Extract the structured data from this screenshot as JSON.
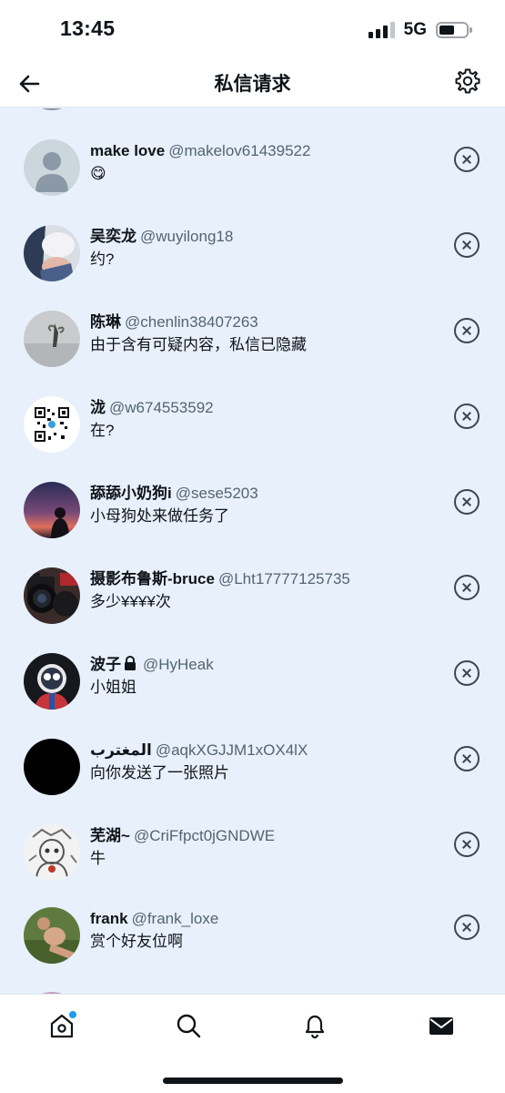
{
  "status_bar": {
    "time": "13:45",
    "network": "5G"
  },
  "nav": {
    "title": "私信请求"
  },
  "requests": [
    {
      "name": "make love",
      "handle": "@makelov61439522",
      "message": "😋",
      "avatar": "default-avatar"
    },
    {
      "name": "吴奕龙",
      "handle": "@wuyilong18",
      "message": "约?",
      "avatar": "photo-avatar"
    },
    {
      "name": "陈琳",
      "handle": "@chenlin38407263",
      "message": "由于含有可疑内容，私信已隐藏",
      "avatar": "photo-avatar"
    },
    {
      "name": "泷",
      "handle": "@w674553592",
      "message": "在?",
      "avatar": "qr-code-avatar"
    },
    {
      "name": "舔舔小奶狗i",
      "handle": "@sese5203",
      "message": "小母狗处来做任务了",
      "avatar": "photo-avatar"
    },
    {
      "name": "摄影布鲁斯-bruce",
      "handle": "@Lht17777125735",
      "message": "多少¥¥¥¥次",
      "avatar": "camera-avatar"
    },
    {
      "name": "波子",
      "handle": "@HyHeak",
      "message": "小姐姐",
      "avatar": "photo-avatar",
      "protected": true
    },
    {
      "name": "المغترب",
      "handle": "@aqkXGJJM1xOX4lX",
      "message": "向你发送了一张照片",
      "avatar": "black-avatar"
    },
    {
      "name": "芜湖~",
      "handle": "@CriFfpct0jGNDWE",
      "message": "牛",
      "avatar": "drawing-avatar"
    },
    {
      "name": "frank",
      "handle": "@frank_loxe",
      "message": "赏个好友位啊",
      "avatar": "photo-avatar"
    }
  ],
  "tabs": [
    {
      "name": "home",
      "icon": "home-icon",
      "has_notification_dot": true
    },
    {
      "name": "search",
      "icon": "search-icon"
    },
    {
      "name": "notifications",
      "icon": "bell-icon"
    },
    {
      "name": "messages",
      "icon": "envelope-icon",
      "active": true
    }
  ],
  "colors": {
    "accent": "#1d9bf0",
    "background": "#e8f1fb",
    "text": "#0f1419",
    "muted": "#536471"
  }
}
